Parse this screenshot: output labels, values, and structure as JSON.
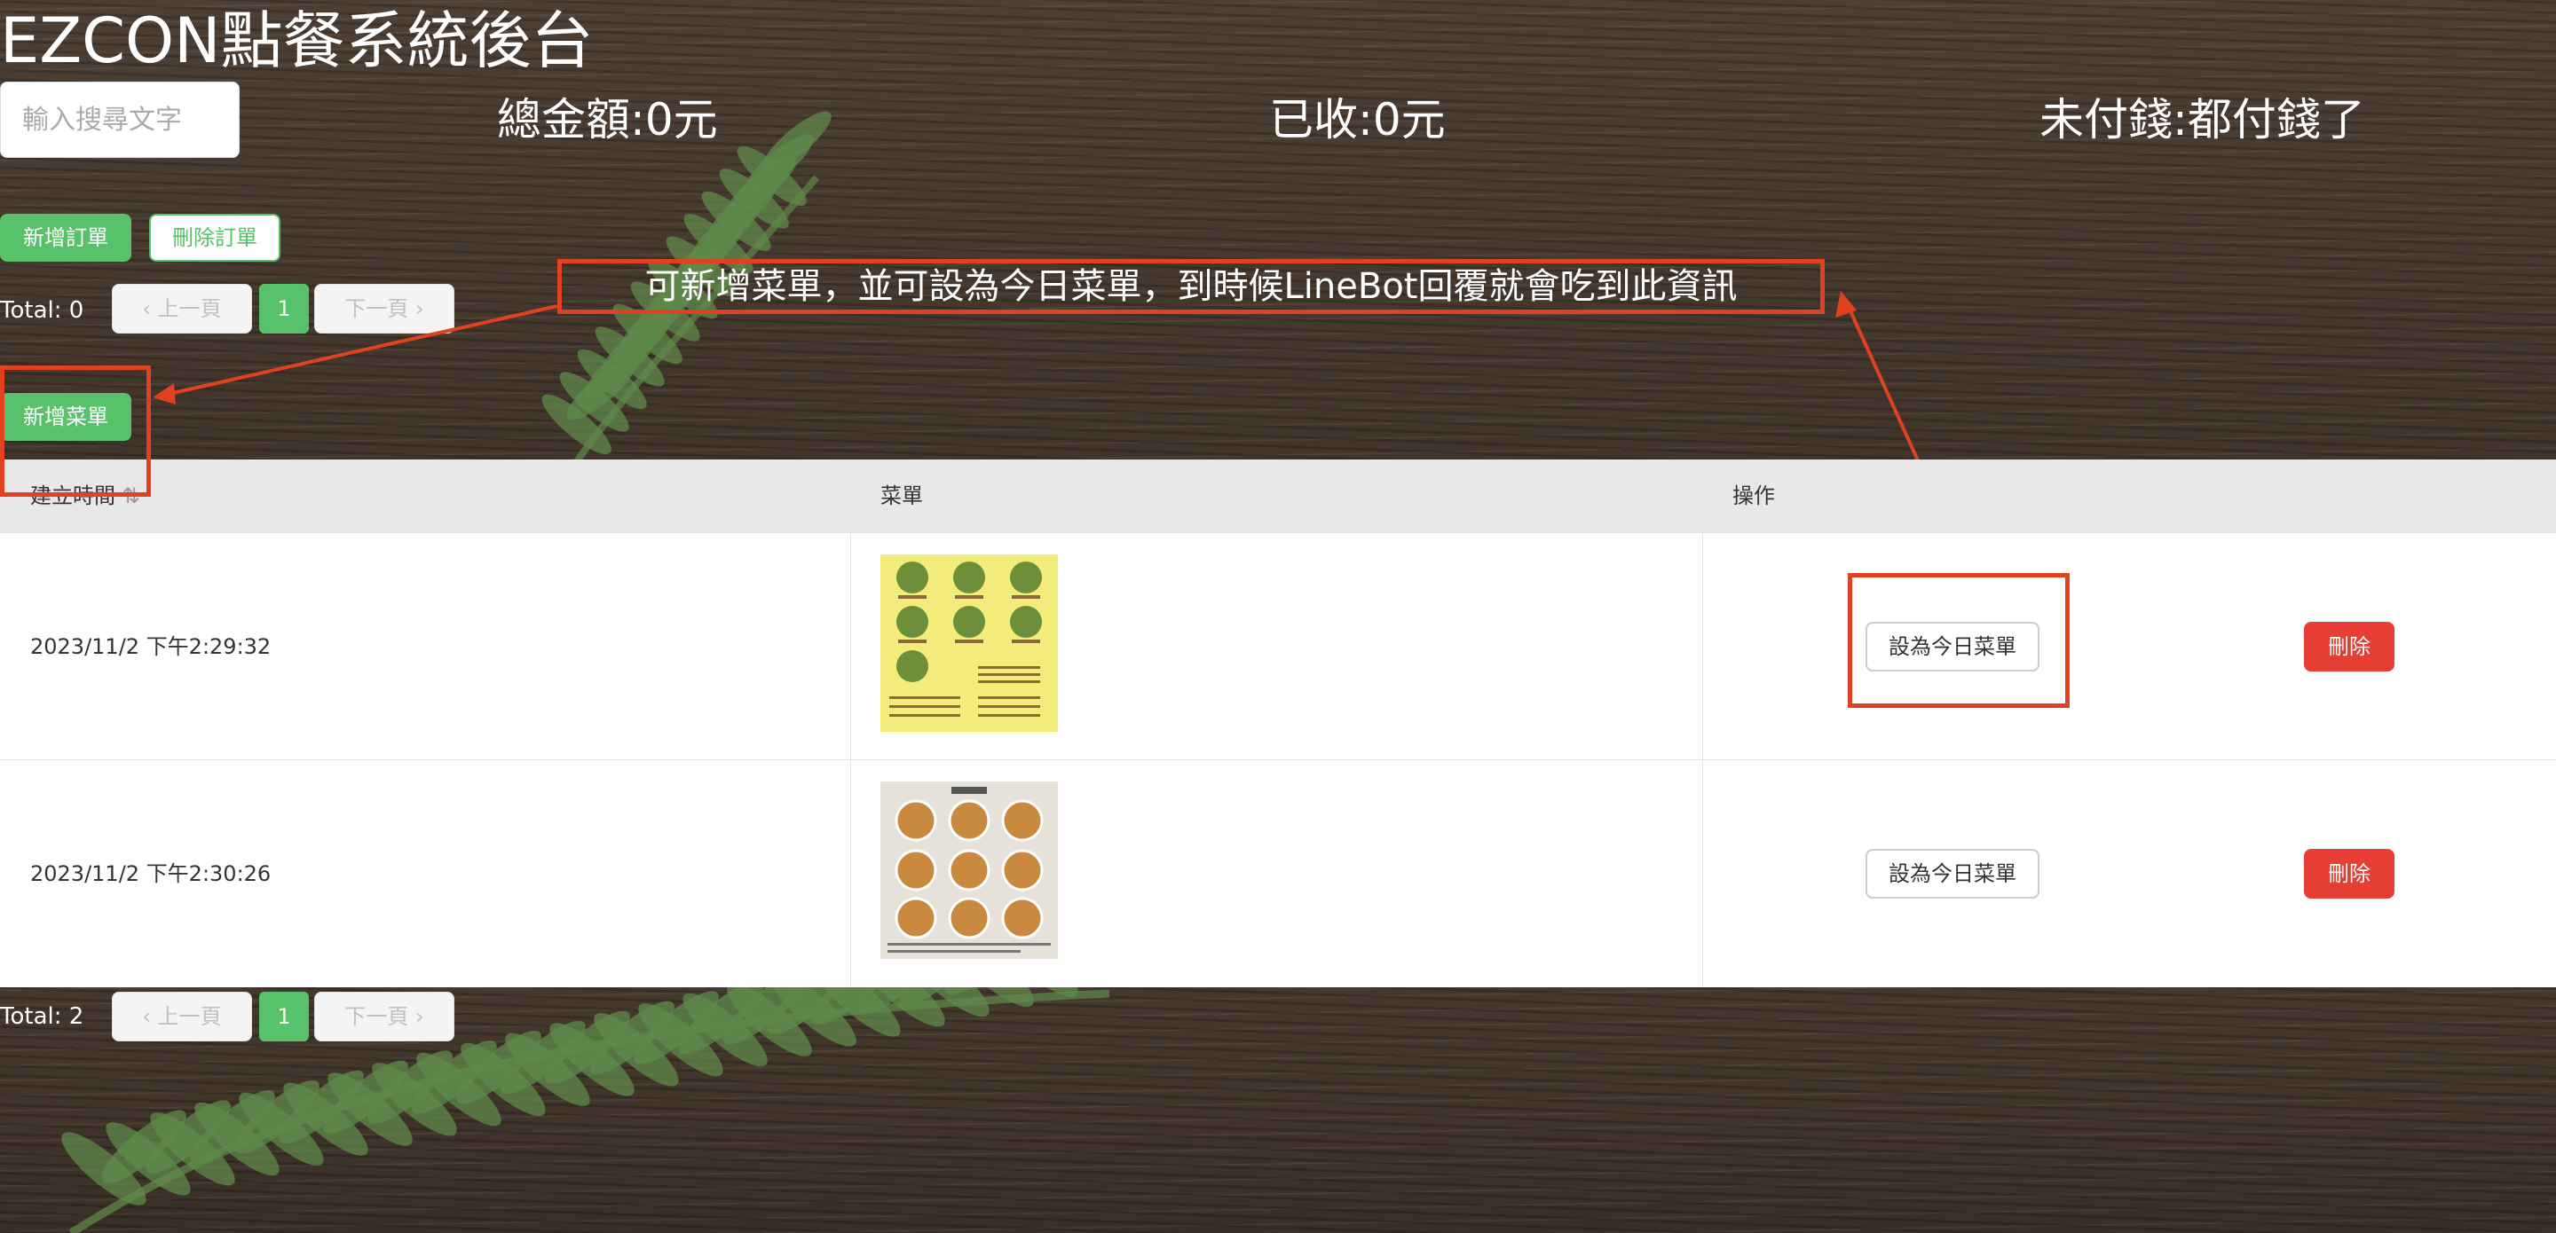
{
  "header": {
    "title": "EZCON點餐系統後台"
  },
  "search": {
    "placeholder": "輸入搜尋文字"
  },
  "stats": {
    "total_amount": "總金額:0元",
    "received": "已收:0元",
    "unpaid": "未付錢:都付錢了"
  },
  "orders": {
    "add_label": "新增訂單",
    "delete_label": "刪除訂單",
    "pagination": {
      "total": "Total: 0",
      "prev": "上一頁",
      "page": "1",
      "next": "下一頁"
    }
  },
  "annotation": {
    "text": "可新增菜單，並可設為今日菜單，到時候LineBot回覆就會吃到此資訊",
    "color": "#e0411f"
  },
  "menus": {
    "add_label": "新增菜單",
    "columns": [
      "建立時間",
      "菜單",
      "操作"
    ],
    "rows": [
      {
        "created": "2023/11/2 下午2:29:32",
        "set_today": "設為今日菜單",
        "delete": "刪除",
        "image_icon": "yellow-menu-image"
      },
      {
        "created": "2023/11/2 下午2:30:26",
        "set_today": "設為今日菜單",
        "delete": "刪除",
        "image_icon": "bowls-menu-image"
      }
    ],
    "pagination": {
      "total": "Total: 2",
      "prev": "上一頁",
      "page": "1",
      "next": "下一頁"
    }
  },
  "colors": {
    "accent": "#57c26a",
    "danger": "#e63d35",
    "annotation": "#e0411f"
  }
}
